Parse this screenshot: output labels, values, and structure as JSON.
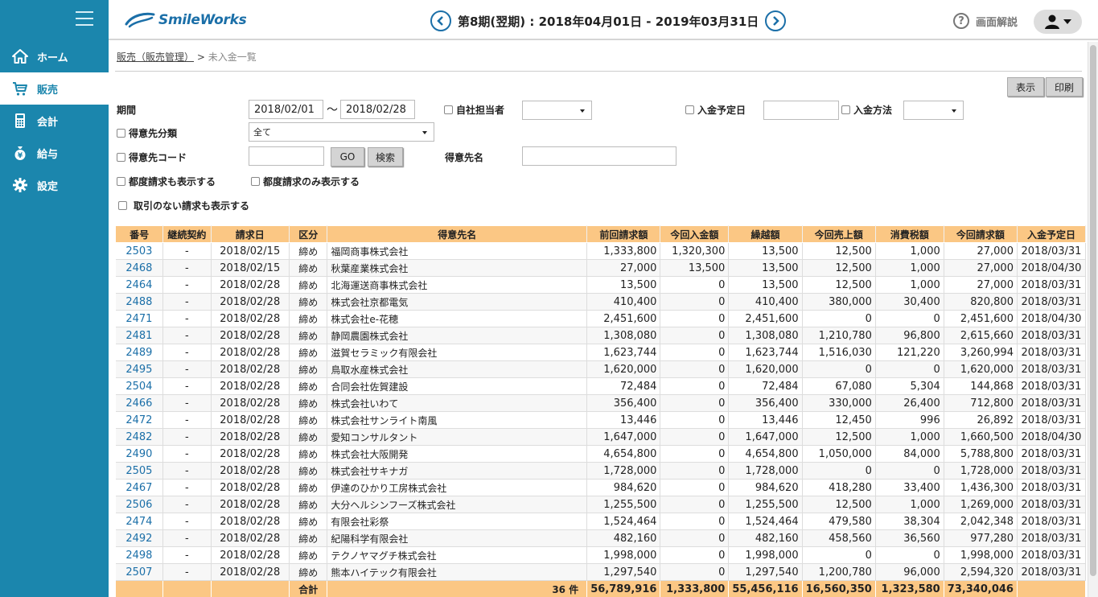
{
  "nav": {
    "items": [
      {
        "label": "ホーム",
        "icon": "home-icon"
      },
      {
        "label": "販売",
        "icon": "cart-icon"
      },
      {
        "label": "会計",
        "icon": "calculator-icon"
      },
      {
        "label": "給与",
        "icon": "money-bag-icon"
      },
      {
        "label": "設定",
        "icon": "gear-icon"
      }
    ]
  },
  "header": {
    "logo": "SmileWorks",
    "period": "第8期(翌期) : 2018年04月01日 - 2019年03月31日",
    "help": "画面解説"
  },
  "breadcrumb": {
    "parent": "販売（販売管理）",
    "separator": ">",
    "current": "未入金一覧"
  },
  "buttons": {
    "display": "表示",
    "print": "印刷",
    "go": "GO",
    "search": "検索"
  },
  "filters": {
    "period_label": "期間",
    "date_from": "2018/02/01",
    "tilde": "〜",
    "date_to": "2018/02/28",
    "own_staff_label": "自社担当者",
    "own_staff_value": "",
    "due_date_label": "入金予定日",
    "due_date_value": "",
    "payment_method_label": "入金方法",
    "payment_method_value": "",
    "customer_class_label": "得意先分類",
    "customer_class_value": "全て",
    "customer_code_label": "得意先コード",
    "customer_code_value": "",
    "customer_name_label": "得意先名",
    "customer_name_value": "",
    "show_each_label": "都度請求も表示する",
    "show_each_only_label": "都度請求のみ表示する",
    "show_no_tx_label": "取引のない請求も表示する"
  },
  "table": {
    "headers": [
      "番号",
      "継続契約",
      "請求日",
      "区分",
      "得意先名",
      "前回請求額",
      "今回入金額",
      "繰越額",
      "今回売上額",
      "消費税額",
      "今回請求額",
      "入金予定日"
    ],
    "rows": [
      [
        "2503",
        "-",
        "2018/02/15",
        "締め",
        "福岡商事株式会社",
        "1,333,800",
        "1,320,300",
        "13,500",
        "12,500",
        "1,000",
        "27,000",
        "2018/03/31"
      ],
      [
        "2468",
        "-",
        "2018/02/15",
        "締め",
        "秋葉産業株式会社",
        "27,000",
        "13,500",
        "13,500",
        "12,500",
        "1,000",
        "27,000",
        "2018/04/30"
      ],
      [
        "2464",
        "-",
        "2018/02/28",
        "締め",
        "北海運送商事株式会社",
        "13,500",
        "0",
        "13,500",
        "12,500",
        "1,000",
        "27,000",
        "2018/03/31"
      ],
      [
        "2488",
        "-",
        "2018/02/28",
        "締め",
        "株式会社京都電気",
        "410,400",
        "0",
        "410,400",
        "380,000",
        "30,400",
        "820,800",
        "2018/03/31"
      ],
      [
        "2471",
        "-",
        "2018/02/28",
        "締め",
        "株式会社e-花穂",
        "2,451,600",
        "0",
        "2,451,600",
        "0",
        "0",
        "2,451,600",
        "2018/04/30"
      ],
      [
        "2481",
        "-",
        "2018/02/28",
        "締め",
        "静岡農園株式会社",
        "1,308,080",
        "0",
        "1,308,080",
        "1,210,780",
        "96,800",
        "2,615,660",
        "2018/03/31"
      ],
      [
        "2489",
        "-",
        "2018/02/28",
        "締め",
        "滋賀セラミック有限会社",
        "1,623,744",
        "0",
        "1,623,744",
        "1,516,030",
        "121,220",
        "3,260,994",
        "2018/03/31"
      ],
      [
        "2495",
        "-",
        "2018/02/28",
        "締め",
        "鳥取水産株式会社",
        "1,620,000",
        "0",
        "1,620,000",
        "0",
        "0",
        "1,620,000",
        "2018/03/31"
      ],
      [
        "2504",
        "-",
        "2018/02/28",
        "締め",
        "合同会社佐賀建設",
        "72,484",
        "0",
        "72,484",
        "67,080",
        "5,304",
        "144,868",
        "2018/03/31"
      ],
      [
        "2466",
        "-",
        "2018/02/28",
        "締め",
        "株式会社いわて",
        "356,400",
        "0",
        "356,400",
        "330,000",
        "26,400",
        "712,800",
        "2018/03/31"
      ],
      [
        "2472",
        "-",
        "2018/02/28",
        "締め",
        "株式会社サンライト南風",
        "13,446",
        "0",
        "13,446",
        "12,450",
        "996",
        "26,892",
        "2018/03/31"
      ],
      [
        "2482",
        "-",
        "2018/02/28",
        "締め",
        "愛知コンサルタント",
        "1,647,000",
        "0",
        "1,647,000",
        "12,500",
        "1,000",
        "1,660,500",
        "2018/04/30"
      ],
      [
        "2490",
        "-",
        "2018/02/28",
        "締め",
        "株式会社大阪開発",
        "4,654,800",
        "0",
        "4,654,800",
        "1,050,000",
        "84,000",
        "5,788,800",
        "2018/03/31"
      ],
      [
        "2505",
        "-",
        "2018/02/28",
        "締め",
        "株式会社サキナガ",
        "1,728,000",
        "0",
        "1,728,000",
        "0",
        "0",
        "1,728,000",
        "2018/03/31"
      ],
      [
        "2467",
        "-",
        "2018/02/28",
        "締め",
        "伊達のひかり工房株式会社",
        "984,620",
        "0",
        "984,620",
        "418,280",
        "33,400",
        "1,436,300",
        "2018/03/31"
      ],
      [
        "2506",
        "-",
        "2018/02/28",
        "締め",
        "大分ヘルシンフーズ株式会社",
        "1,255,500",
        "0",
        "1,255,500",
        "12,500",
        "1,000",
        "1,269,000",
        "2018/03/31"
      ],
      [
        "2474",
        "-",
        "2018/02/28",
        "締め",
        "有限会社彩祭",
        "1,524,464",
        "0",
        "1,524,464",
        "479,580",
        "38,304",
        "2,042,348",
        "2018/03/31"
      ],
      [
        "2492",
        "-",
        "2018/02/28",
        "締め",
        "紀陽科学有限会社",
        "482,160",
        "0",
        "482,160",
        "458,560",
        "36,560",
        "977,280",
        "2018/03/31"
      ],
      [
        "2498",
        "-",
        "2018/02/28",
        "締め",
        "テクノヤマグチ株式会社",
        "1,998,000",
        "0",
        "1,998,000",
        "0",
        "0",
        "1,998,000",
        "2018/03/31"
      ],
      [
        "2507",
        "-",
        "2018/02/28",
        "締め",
        "熊本ハイテック有限会社",
        "1,297,540",
        "0",
        "1,297,540",
        "1,200,780",
        "96,000",
        "2,594,320",
        "2018/03/31"
      ]
    ],
    "footer": {
      "label": "合計",
      "count": "36 件",
      "prev_billed": "56,789,916",
      "received": "1,333,800",
      "carryover": "55,456,116",
      "sales": "16,560,350",
      "tax": "1,323,580",
      "billed": "73,340,046"
    }
  }
}
